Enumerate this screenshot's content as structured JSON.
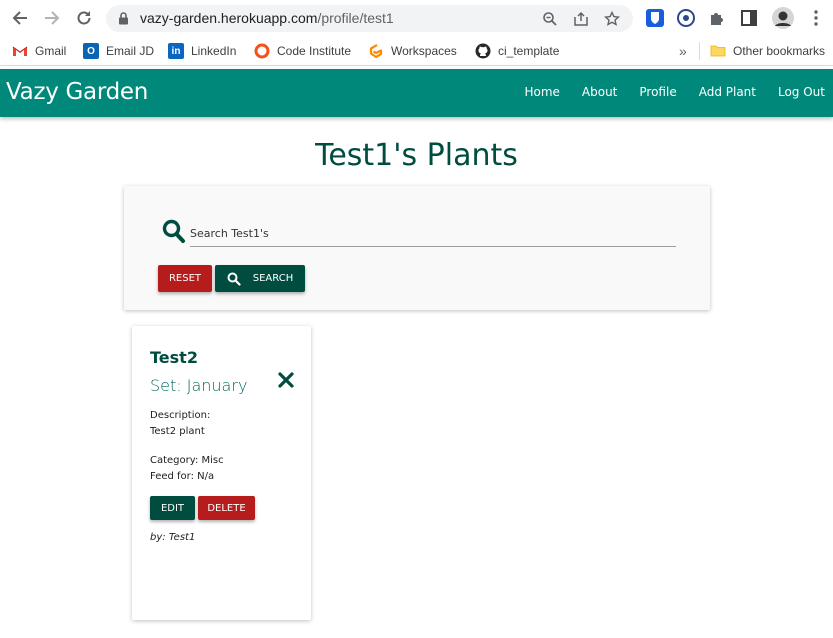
{
  "browser": {
    "url_host": "vazy-garden.herokuapp.com",
    "url_path": "/profile/test1",
    "bookmarks": [
      {
        "label": "Gmail",
        "icon": "gmail-icon",
        "color": "#ea4335"
      },
      {
        "label": "Email JD",
        "icon": "outlook-icon",
        "color": "#0a64b4"
      },
      {
        "label": "LinkedIn",
        "icon": "linkedin-icon",
        "color": "#0a66c2"
      },
      {
        "label": "Code Institute",
        "icon": "code-institute-icon",
        "color": "#f4511e"
      },
      {
        "label": "Workspaces",
        "icon": "gitpod-icon",
        "color": "#ff8a00"
      },
      {
        "label": "ci_template",
        "icon": "github-icon",
        "color": "#24292e"
      }
    ],
    "overflow_label": "»",
    "other_bookmarks": "Other bookmarks"
  },
  "site": {
    "brand": "Vazy Garden",
    "nav": [
      "Home",
      "About",
      "Profile",
      "Add Plant",
      "Log Out"
    ],
    "colors": {
      "nav": "#00897b",
      "primary_dark": "#004d40",
      "danger": "#b71c1c"
    }
  },
  "page": {
    "title": "Test1's Plants",
    "search": {
      "placeholder": "Search Test1's",
      "value": "",
      "reset_label": "Reset",
      "search_label": "Search"
    }
  },
  "plants": [
    {
      "name": "Test2",
      "set": "Set: January",
      "description_label": "Description:",
      "description": "Test2 plant",
      "category": "Category: Misc",
      "feed": "Feed for: N/a",
      "edit_label": "Edit",
      "delete_label": "Delete",
      "by": "by: Test1"
    }
  ]
}
